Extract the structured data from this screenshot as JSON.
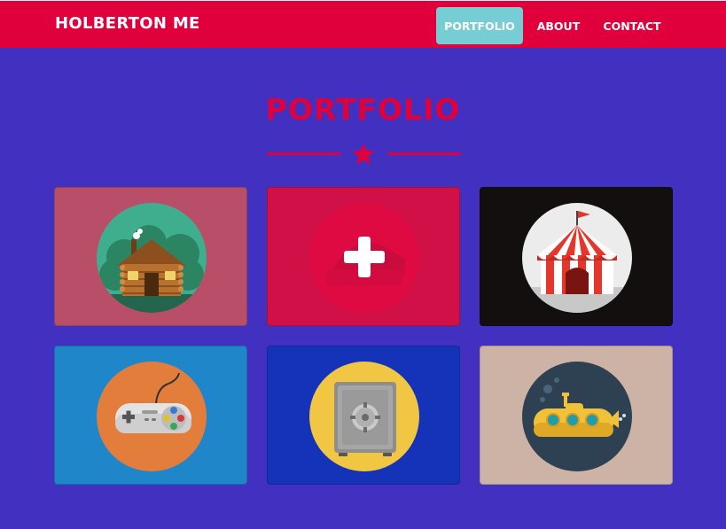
{
  "navbar": {
    "brand": "HOLBERTON ME",
    "items": [
      {
        "label": "PORTFOLIO",
        "active": true
      },
      {
        "label": "ABOUT",
        "active": false
      },
      {
        "label": "CONTACT",
        "active": false
      }
    ]
  },
  "portfolio": {
    "title": "PORTFOLIO",
    "divider_icon": "star-icon",
    "items": [
      {
        "icon": "log-cabin-icon",
        "background": "#b84e68"
      },
      {
        "icon": "cake-icon",
        "background": "#d11048"
      },
      {
        "icon": "circus-tent-icon",
        "background": "#130f0f"
      },
      {
        "icon": "game-controller-icon",
        "background": "#1f86c9"
      },
      {
        "icon": "safe-icon",
        "background": "#1433b8"
      },
      {
        "icon": "submarine-icon",
        "background": "#cdb3a5"
      }
    ]
  },
  "colors": {
    "page_background": "#4230c0",
    "accent": "#e0003c",
    "active_nav": "#76cdd3"
  }
}
